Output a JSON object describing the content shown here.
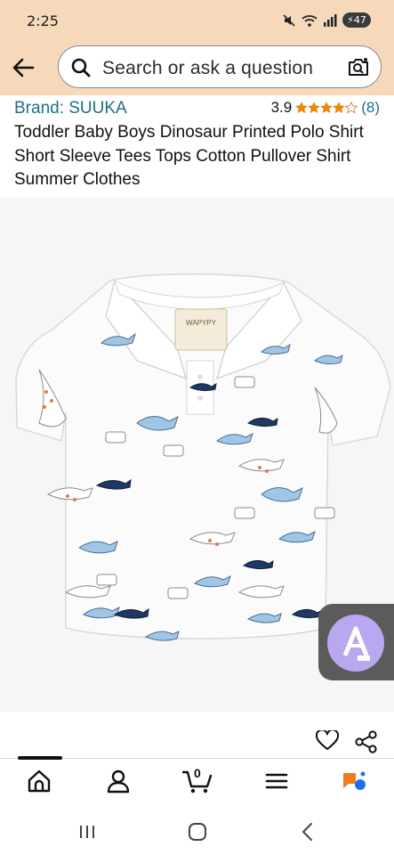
{
  "status_bar": {
    "time": "2:25",
    "battery": "47"
  },
  "search": {
    "placeholder": "Search or ask a question"
  },
  "product": {
    "brand": "Brand: SUUKA",
    "rating_value": "3.9",
    "rating_stars": 3.9,
    "rating_count": "(8)",
    "title": "Toddler Baby Boys Dinosaur Printed Polo Shirt Short Sleeve Tees Tops Cotton Pullover Shirt Summer Clothes",
    "label_text": "WAPYPY"
  },
  "cart": {
    "count": "0"
  },
  "colors": {
    "header_bg": "#f6d9bb",
    "link": "#1b6f8a",
    "star": "#f08804"
  },
  "icons": {
    "back": "back-arrow-icon",
    "search": "search-icon",
    "camera": "camera-search-icon",
    "heart": "heart-icon",
    "share": "share-icon",
    "home": "home-icon",
    "account": "account-icon",
    "cart": "cart-icon",
    "menu": "menu-icon",
    "rufus": "rufus-assistant-icon",
    "translate": "translate-icon"
  }
}
